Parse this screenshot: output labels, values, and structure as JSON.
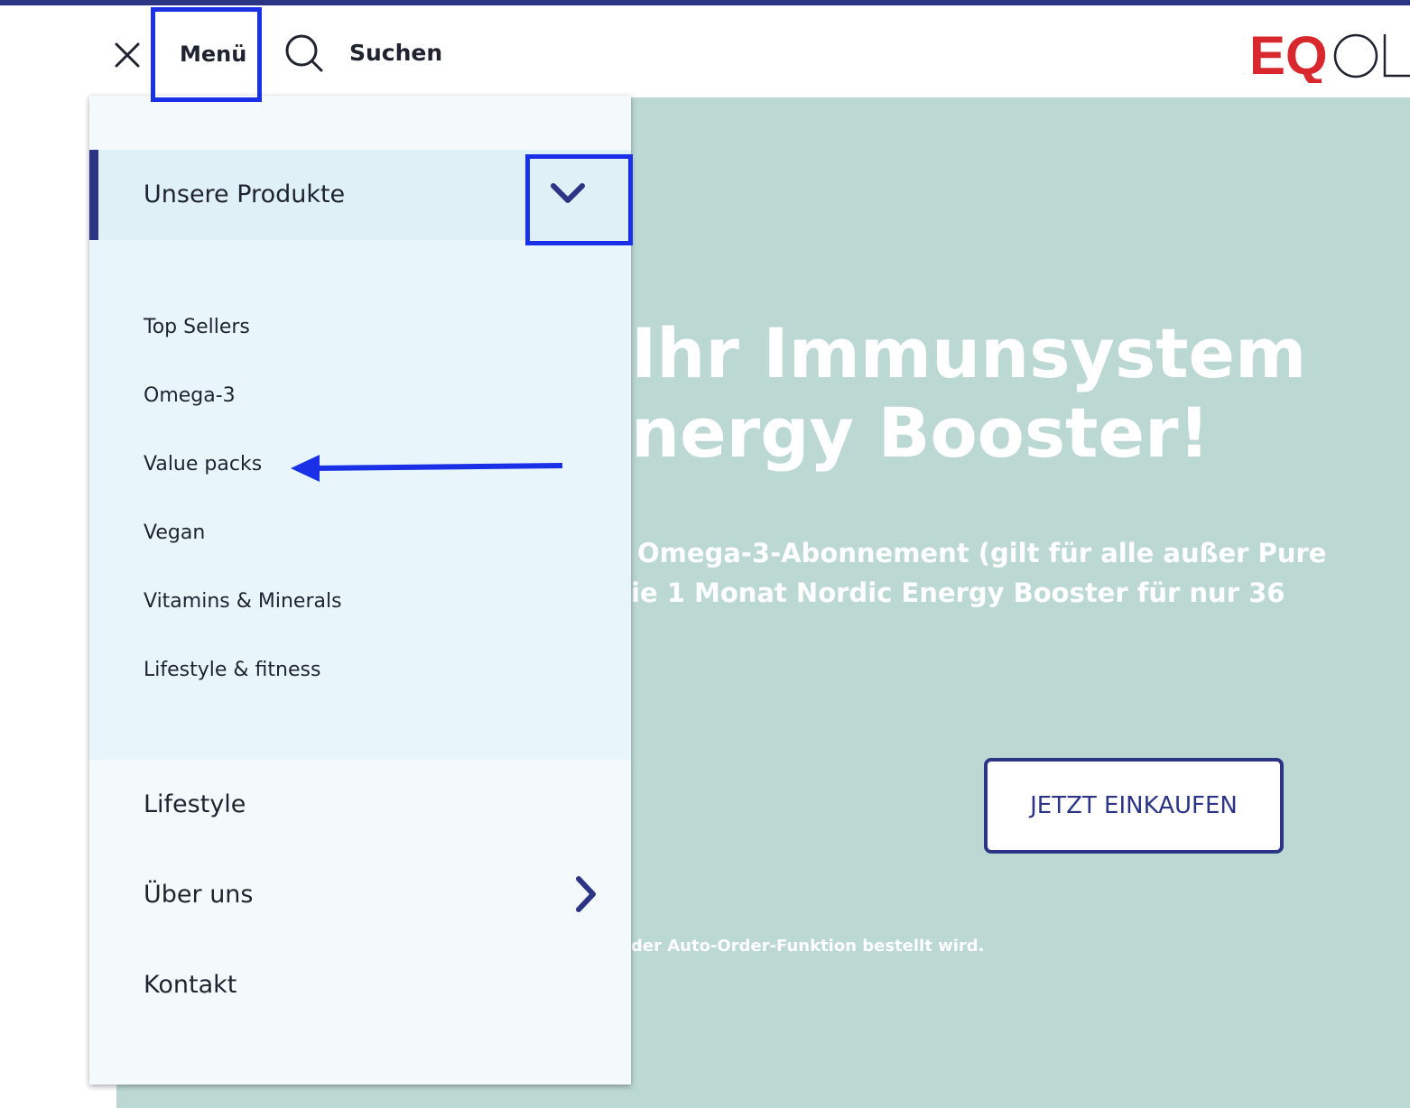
{
  "header": {
    "close_icon": "close-icon",
    "menu_label": "Menü",
    "search_icon": "search-icon",
    "search_label": "Suchen",
    "logo_text": "EQOLOGY"
  },
  "hero": {
    "title_line1": "Ihr Immunsystem",
    "title_line2": "nergy Booster!",
    "subtitle_line1": "Omega-3-Abonnement (gilt für alle außer Pure",
    "subtitle_line2": "ie 1 Monat Nordic Energy Booster für nur 36",
    "cta_label": "JETZT EINKAUFEN",
    "footnote": "der Auto-Order-Funktion bestellt wird."
  },
  "menu": {
    "products_label": "Unsere Produkte",
    "products_expanded": true,
    "sub_items": [
      "Top Sellers",
      "Omega-3",
      "Value packs",
      "Vegan",
      "Vitamins & Minerals",
      "Lifestyle & fitness"
    ],
    "main_items": [
      "Lifestyle",
      "Über uns",
      "Kontakt"
    ]
  },
  "colors": {
    "accent": "#2b3485",
    "hero_bg": "#bcd8d3",
    "highlight": "#1930e6",
    "logo_red": "#d8282e"
  }
}
